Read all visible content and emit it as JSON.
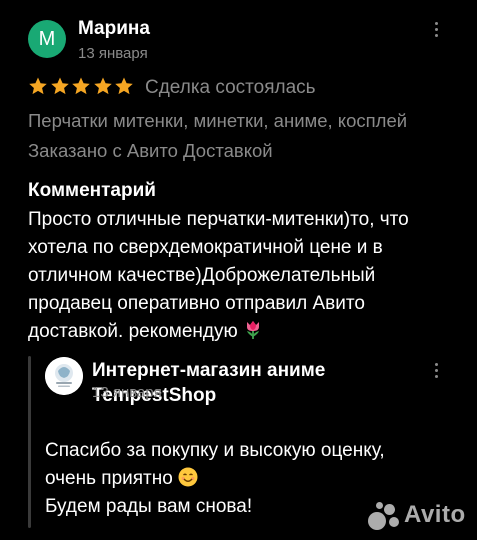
{
  "reviewer": {
    "initial": "М",
    "name": "Марина",
    "date": "13 января",
    "avatar_color": "#19a974",
    "rating": 5,
    "deal_status": "Сделка состоялась"
  },
  "order": {
    "product": "Перчатки митенки, минетки, аниме, косплей",
    "delivery": "Заказано с Авито Доставкой"
  },
  "comment": {
    "heading": "Комментарий",
    "lines": [
      "Просто отличные перчатки-митенки)то, что",
      "хотела по сверхдемократичной цене и в",
      "отличном качестве)Доброжелательный",
      "продавец оперативно отправил Авито",
      "доставкой. рекомендую"
    ],
    "emoji": "tulip"
  },
  "reply": {
    "shop_name": "Интернет-магазин аниме TempestShop",
    "date": "13 января",
    "lines": [
      "Спасибо за покупку и высокую оценку,",
      "очень приятно",
      "Будем рады вам снова!"
    ],
    "emoji": "smiling-face"
  },
  "watermark": {
    "text": "Avito"
  },
  "colors": {
    "background": "#000000",
    "star": "#f5a623",
    "muted_text": "#8a8a8a"
  },
  "icons": [
    "star-icon",
    "more-vertical-icon",
    "tulip-emoji",
    "smiling-face-emoji",
    "avito-logo"
  ]
}
